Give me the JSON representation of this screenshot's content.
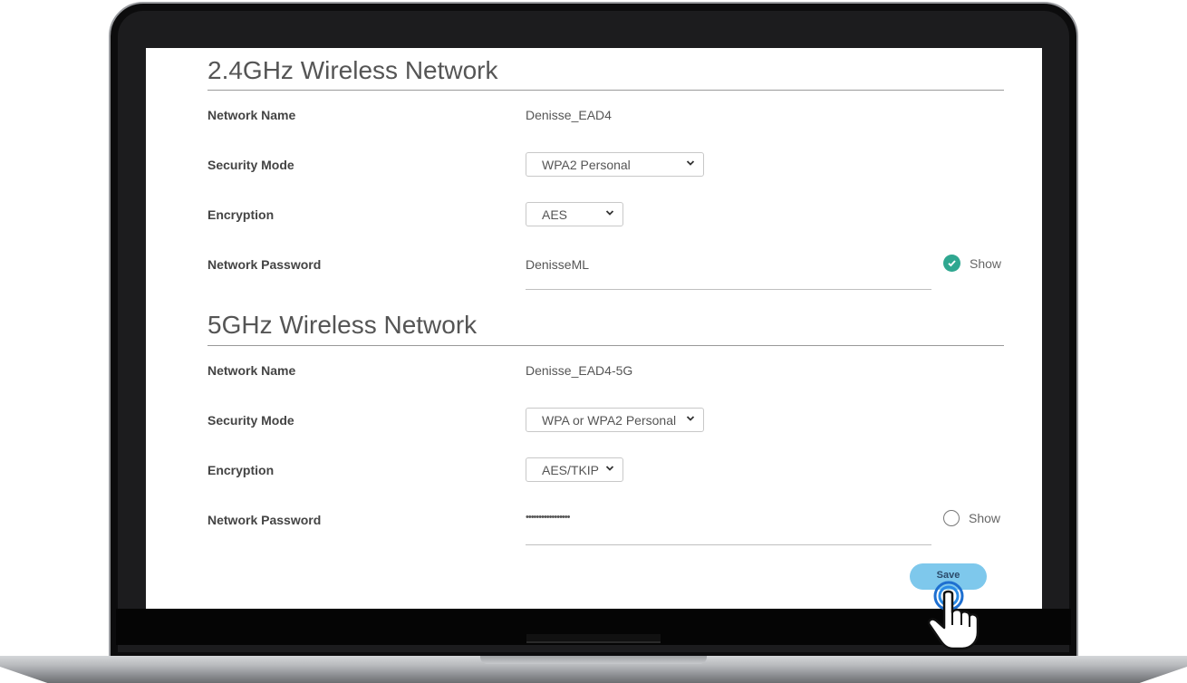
{
  "network_24": {
    "title": "2.4GHz Wireless Network",
    "network_name_label": "Network Name",
    "network_name_value": "Denisse_EAD4",
    "security_mode_label": "Security Mode",
    "security_mode_value": "WPA2 Personal",
    "encryption_label": "Encryption",
    "encryption_value": "AES",
    "password_label": "Network Password",
    "password_value": "DenisseML",
    "show_label": "Show",
    "show_checked": true
  },
  "network_5": {
    "title": "5GHz Wireless Network",
    "network_name_label": "Network Name",
    "network_name_value": "Denisse_EAD4-5G",
    "security_mode_label": "Security Mode",
    "security_mode_value": "WPA or WPA2 Personal",
    "encryption_label": "Encryption",
    "encryption_value": "AES/TKIP",
    "password_label": "Network Password",
    "password_value": "•••••••••••••••••",
    "show_label": "Show",
    "show_checked": false
  },
  "actions": {
    "save_label": "Save"
  },
  "colors": {
    "accent_check": "#2fa790",
    "save_button": "#7ec8ec",
    "cursor_ring": "#1e6fd0"
  },
  "icons": {
    "chevron": "chevron-down-icon",
    "check": "check-circle-icon",
    "cursor": "hand-pointer-icon"
  }
}
